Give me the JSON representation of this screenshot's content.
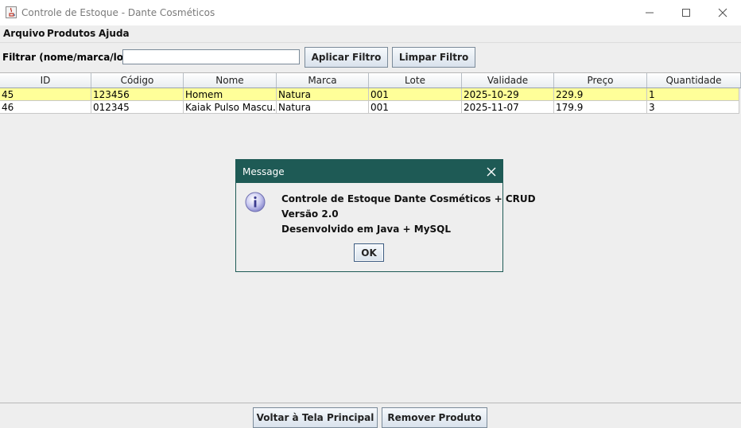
{
  "window": {
    "title": "Controle de Estoque - Dante Cosméticos"
  },
  "menu": [
    "Arquivo",
    "Produtos",
    "Ajuda"
  ],
  "filter": {
    "label": "Filtrar (nome/marca/lote):",
    "value": "",
    "apply_label": "Aplicar Filtro",
    "clear_label": "Limpar Filtro"
  },
  "table": {
    "columns": [
      "ID",
      "Código",
      "Nome",
      "Marca",
      "Lote",
      "Validade",
      "Preço",
      "Quantidade"
    ],
    "rows": [
      [
        "45",
        "123456",
        "Homem",
        "Natura",
        "001",
        "2025-10-29",
        "229.9",
        "1"
      ],
      [
        "46",
        "012345",
        "Kaiak Pulso Mascu...",
        "Natura",
        "001",
        "2025-11-07",
        "179.9",
        "3"
      ]
    ],
    "highlight_color": "#ffff99"
  },
  "dialog": {
    "title": "Message",
    "icon": "info-icon",
    "lines": [
      "Controle de Estoque Dante Cosméticos + CRUD",
      "Versão 2.0",
      "Desenvolvido em Java + MySQL"
    ],
    "ok_label": "OK",
    "title_color": "#1e5a55"
  },
  "footer": {
    "back_label": "Voltar à Tela Principal",
    "remove_label": "Remover Produto"
  }
}
